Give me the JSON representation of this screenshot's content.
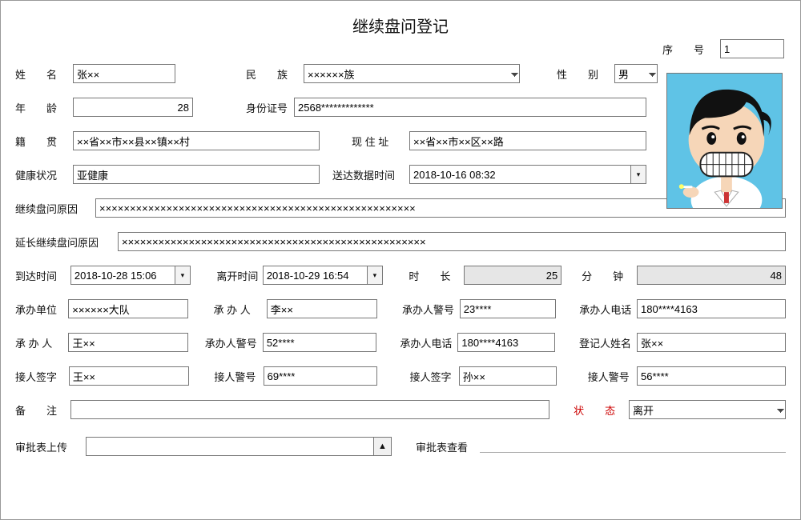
{
  "title": "继续盘问登记",
  "seq": {
    "label": "序　　号",
    "value": "1"
  },
  "fields": {
    "name_label": "姓　　名",
    "name": "张××",
    "ethnicity_label": "民　　族",
    "ethnicity": "××××××族",
    "gender_label": "性　　别",
    "gender": "男",
    "age_label": "年　　龄",
    "age": "28",
    "idcard_label": "身份证号",
    "idcard": "2568*************",
    "origin_label": "籍　　贯",
    "origin": "××省××市××县××镇××村",
    "address_label": "现 住 址",
    "address": "××省××市××区××路",
    "health_label": "健康状况",
    "health": "亚健康",
    "delivery_label": "送达数据时间",
    "delivery": "2018-10-16 08:32",
    "reason_label": "继续盘问原因",
    "reason": "××××××××××××××××××××××××××××××××××××××××××××××××××××",
    "ext_reason_label": "延长继续盘问原因",
    "ext_reason": "××××××××××××××××××××××××××××××××××××××××××××××××××",
    "arrive_label": "到达时间",
    "arrive": "2018-10-28 15:06",
    "leave_label": "离开时间",
    "leave": "2018-10-29 16:54",
    "duration_label": "时　　长",
    "duration": "25",
    "minutes_label": "分　　钟",
    "minutes": "48",
    "unit_label": "承办单位",
    "unit": "××××××大队",
    "handler1_label": "承 办 人",
    "handler1": "李××",
    "handler1_badge_label": "承办人警号",
    "handler1_badge": "23****",
    "handler1_phone_label": "承办人电话",
    "handler1_phone": "180****4163",
    "handler2_label": "承 办 人",
    "handler2": "王××",
    "handler2_badge_label": "承办人警号",
    "handler2_badge": "52****",
    "handler2_phone_label": "承办人电话",
    "handler2_phone": "180****4163",
    "registrar_label": "登记人姓名",
    "registrar": "张××",
    "recv1_sign_label": "接人签字",
    "recv1_sign": "王××",
    "recv1_badge_label": "接人警号",
    "recv1_badge": "69****",
    "recv2_sign_label": "接人签字",
    "recv2_sign": "孙××",
    "recv2_badge_label": "接人警号",
    "recv2_badge": "56****",
    "remark_label": "备　　注",
    "remark": "",
    "status_label": "状　　态",
    "status": "离开",
    "upload_label": "审批表上传",
    "view_label": "审批表查看"
  }
}
